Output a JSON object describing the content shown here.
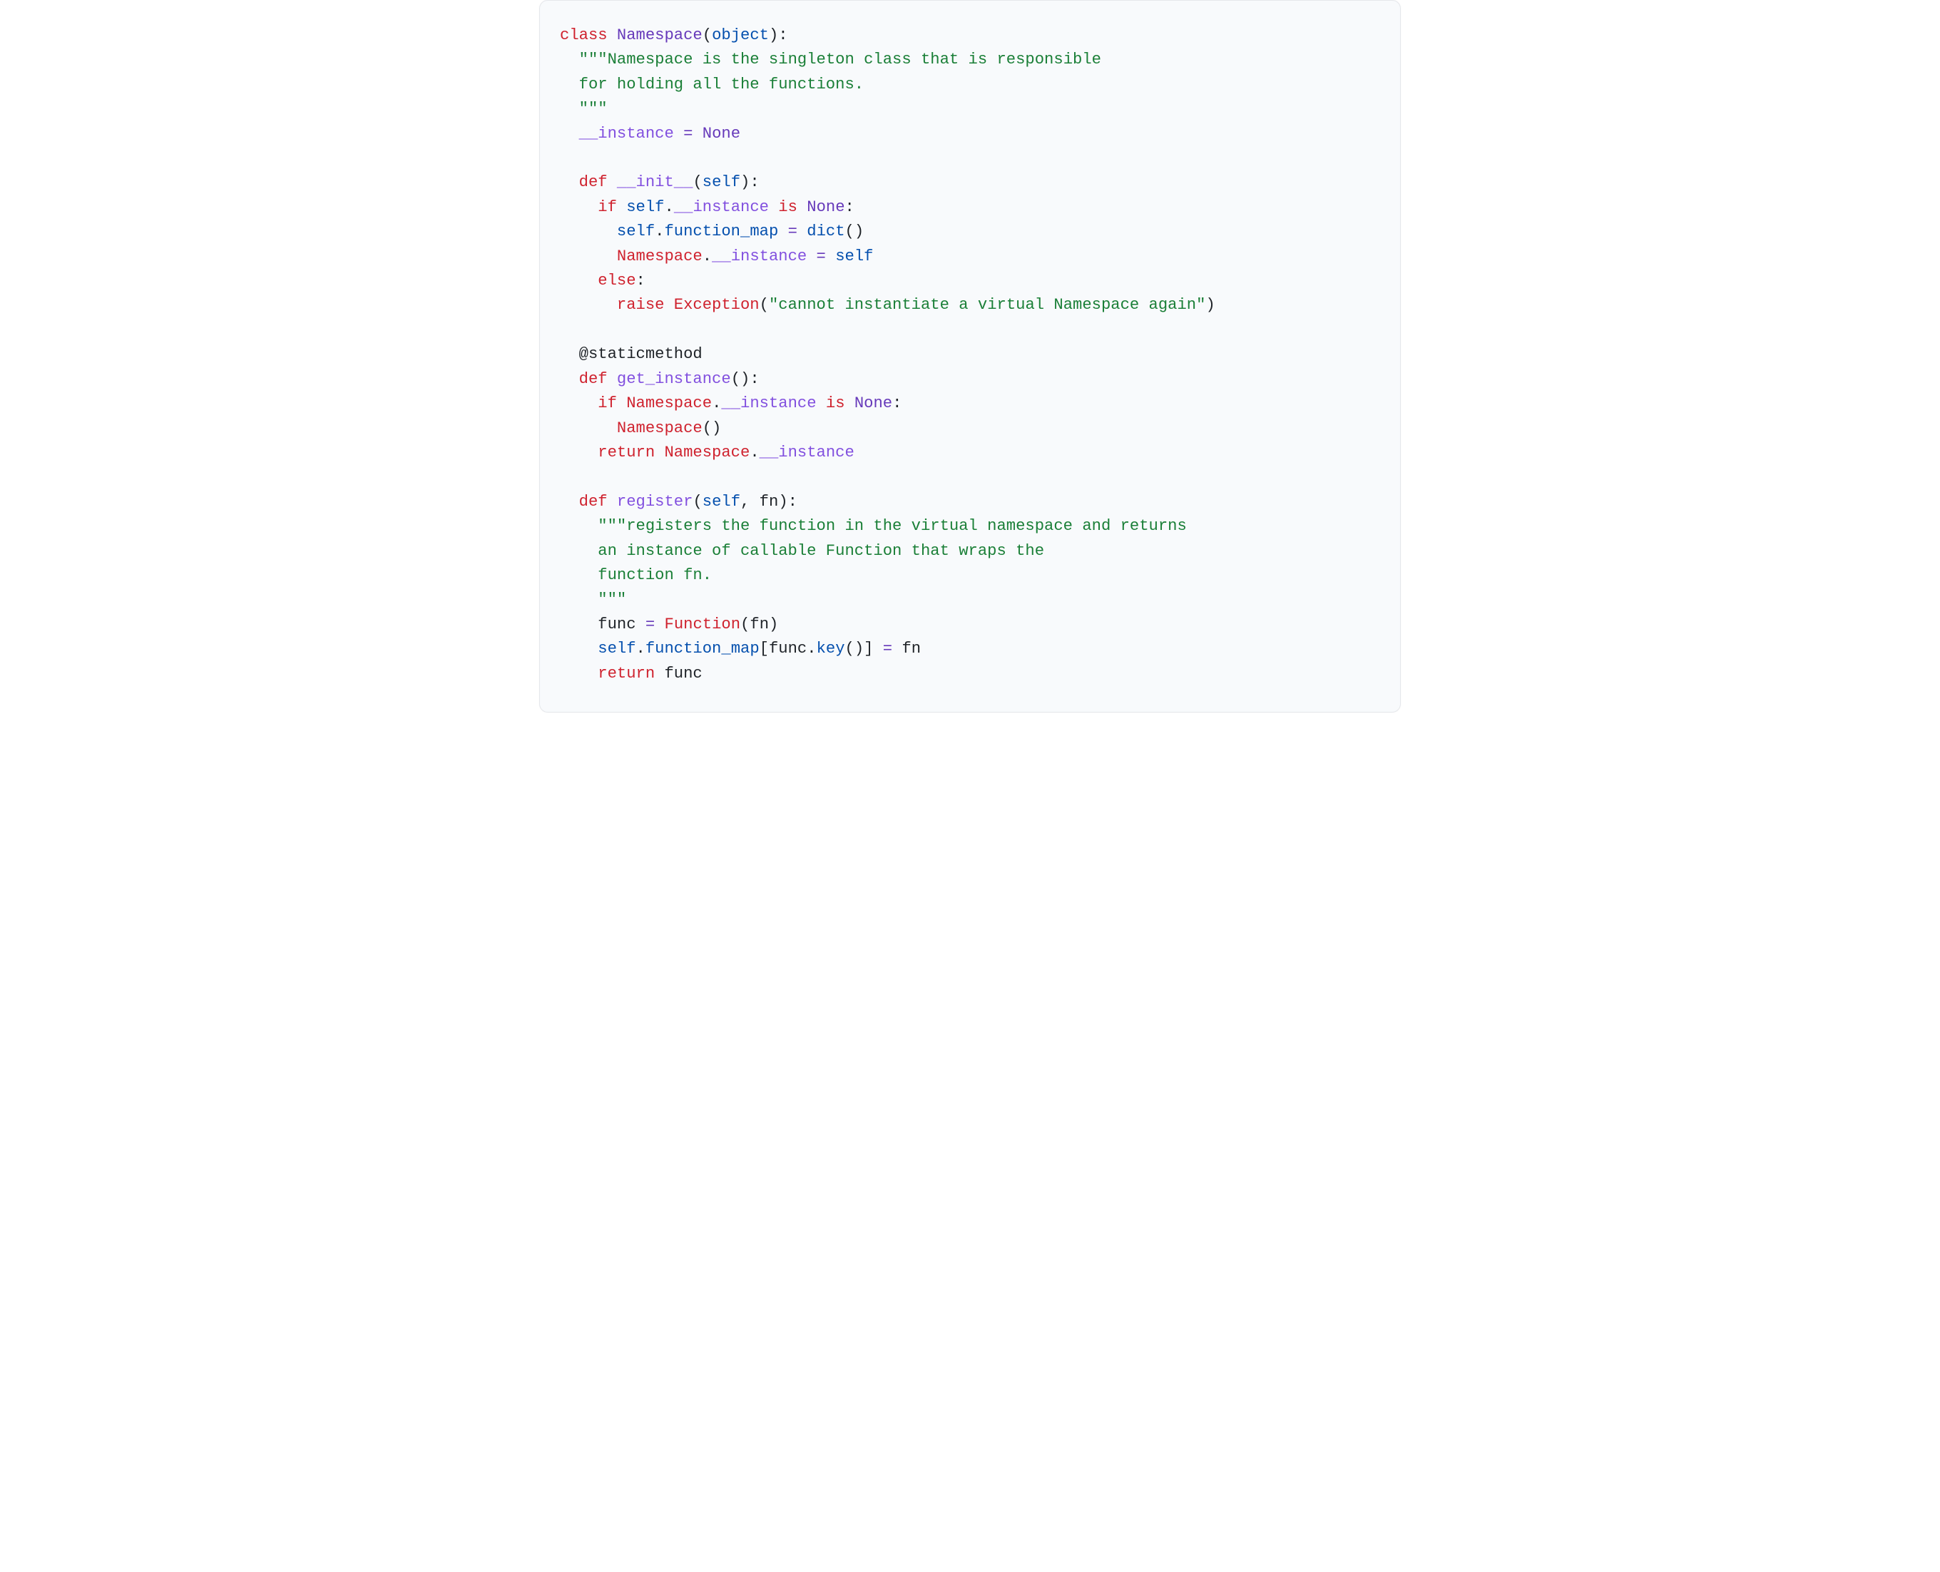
{
  "code": {
    "lines": [
      [
        {
          "t": "class ",
          "c": "kw"
        },
        {
          "t": "Namespace",
          "c": "cls"
        },
        {
          "t": "(",
          "c": "pun"
        },
        {
          "t": "object",
          "c": "bi"
        },
        {
          "t": "):",
          "c": "pun"
        }
      ],
      [
        {
          "t": "  ",
          "c": "pun"
        },
        {
          "t": "\"\"\"Namespace is the singleton class that is responsible",
          "c": "str"
        }
      ],
      [
        {
          "t": "  for holding all the functions.",
          "c": "str"
        }
      ],
      [
        {
          "t": "  \"\"\"",
          "c": "str"
        }
      ],
      [
        {
          "t": "  ",
          "c": "pun"
        },
        {
          "t": "__instance",
          "c": "dun"
        },
        {
          "t": " ",
          "c": "pun"
        },
        {
          "t": "=",
          "c": "op"
        },
        {
          "t": " ",
          "c": "pun"
        },
        {
          "t": "None",
          "c": "cls"
        }
      ],
      [
        {
          "t": "",
          "c": "pun"
        }
      ],
      [
        {
          "t": "  ",
          "c": "pun"
        },
        {
          "t": "def ",
          "c": "kw"
        },
        {
          "t": "__init__",
          "c": "fn"
        },
        {
          "t": "(",
          "c": "pun"
        },
        {
          "t": "self",
          "c": "self"
        },
        {
          "t": "):",
          "c": "pun"
        }
      ],
      [
        {
          "t": "    ",
          "c": "pun"
        },
        {
          "t": "if ",
          "c": "kw"
        },
        {
          "t": "self",
          "c": "self"
        },
        {
          "t": ".",
          "c": "pun"
        },
        {
          "t": "__instance",
          "c": "dun"
        },
        {
          "t": " ",
          "c": "pun"
        },
        {
          "t": "is ",
          "c": "kw"
        },
        {
          "t": "None",
          "c": "cls"
        },
        {
          "t": ":",
          "c": "pun"
        }
      ],
      [
        {
          "t": "      ",
          "c": "pun"
        },
        {
          "t": "self",
          "c": "self"
        },
        {
          "t": ".",
          "c": "pun"
        },
        {
          "t": "function_map",
          "c": "attr"
        },
        {
          "t": " ",
          "c": "pun"
        },
        {
          "t": "=",
          "c": "op"
        },
        {
          "t": " ",
          "c": "pun"
        },
        {
          "t": "dict",
          "c": "bi"
        },
        {
          "t": "()",
          "c": "pun"
        }
      ],
      [
        {
          "t": "      ",
          "c": "pun"
        },
        {
          "t": "Namespace",
          "c": "callr"
        },
        {
          "t": ".",
          "c": "pun"
        },
        {
          "t": "__instance",
          "c": "dun"
        },
        {
          "t": " ",
          "c": "pun"
        },
        {
          "t": "=",
          "c": "op"
        },
        {
          "t": " ",
          "c": "pun"
        },
        {
          "t": "self",
          "c": "self"
        }
      ],
      [
        {
          "t": "    ",
          "c": "pun"
        },
        {
          "t": "else",
          "c": "kw"
        },
        {
          "t": ":",
          "c": "pun"
        }
      ],
      [
        {
          "t": "      ",
          "c": "pun"
        },
        {
          "t": "raise ",
          "c": "kw"
        },
        {
          "t": "Exception",
          "c": "callr"
        },
        {
          "t": "(",
          "c": "pun"
        },
        {
          "t": "\"cannot instantiate a virtual Namespace again\"",
          "c": "str"
        },
        {
          "t": ")",
          "c": "pun"
        }
      ],
      [
        {
          "t": "",
          "c": "pun"
        }
      ],
      [
        {
          "t": "  ",
          "c": "pun"
        },
        {
          "t": "@staticmethod",
          "c": "decor"
        }
      ],
      [
        {
          "t": "  ",
          "c": "pun"
        },
        {
          "t": "def ",
          "c": "kw"
        },
        {
          "t": "get_instance",
          "c": "fn"
        },
        {
          "t": "():",
          "c": "pun"
        }
      ],
      [
        {
          "t": "    ",
          "c": "pun"
        },
        {
          "t": "if ",
          "c": "kw"
        },
        {
          "t": "Namespace",
          "c": "callr"
        },
        {
          "t": ".",
          "c": "pun"
        },
        {
          "t": "__instance",
          "c": "dun"
        },
        {
          "t": " ",
          "c": "pun"
        },
        {
          "t": "is ",
          "c": "kw"
        },
        {
          "t": "None",
          "c": "cls"
        },
        {
          "t": ":",
          "c": "pun"
        }
      ],
      [
        {
          "t": "      ",
          "c": "pun"
        },
        {
          "t": "Namespace",
          "c": "callr"
        },
        {
          "t": "()",
          "c": "pun"
        }
      ],
      [
        {
          "t": "    ",
          "c": "pun"
        },
        {
          "t": "return ",
          "c": "kw"
        },
        {
          "t": "Namespace",
          "c": "callr"
        },
        {
          "t": ".",
          "c": "pun"
        },
        {
          "t": "__instance",
          "c": "dun"
        }
      ],
      [
        {
          "t": "",
          "c": "pun"
        }
      ],
      [
        {
          "t": "  ",
          "c": "pun"
        },
        {
          "t": "def ",
          "c": "kw"
        },
        {
          "t": "register",
          "c": "fn"
        },
        {
          "t": "(",
          "c": "pun"
        },
        {
          "t": "self",
          "c": "self"
        },
        {
          "t": ", ",
          "c": "pun"
        },
        {
          "t": "fn",
          "c": "id"
        },
        {
          "t": "):",
          "c": "pun"
        }
      ],
      [
        {
          "t": "    ",
          "c": "pun"
        },
        {
          "t": "\"\"\"registers the function in the virtual namespace and returns",
          "c": "str"
        }
      ],
      [
        {
          "t": "    an instance of callable Function that wraps the",
          "c": "str"
        }
      ],
      [
        {
          "t": "    function fn.",
          "c": "str"
        }
      ],
      [
        {
          "t": "    \"\"\"",
          "c": "str"
        }
      ],
      [
        {
          "t": "    ",
          "c": "pun"
        },
        {
          "t": "func",
          "c": "id"
        },
        {
          "t": " ",
          "c": "pun"
        },
        {
          "t": "=",
          "c": "op"
        },
        {
          "t": " ",
          "c": "pun"
        },
        {
          "t": "Function",
          "c": "callr"
        },
        {
          "t": "(",
          "c": "pun"
        },
        {
          "t": "fn",
          "c": "id"
        },
        {
          "t": ")",
          "c": "pun"
        }
      ],
      [
        {
          "t": "    ",
          "c": "pun"
        },
        {
          "t": "self",
          "c": "self"
        },
        {
          "t": ".",
          "c": "pun"
        },
        {
          "t": "function_map",
          "c": "attr"
        },
        {
          "t": "[",
          "c": "pun"
        },
        {
          "t": "func",
          "c": "id"
        },
        {
          "t": ".",
          "c": "pun"
        },
        {
          "t": "key",
          "c": "attr"
        },
        {
          "t": "()]",
          "c": "pun"
        },
        {
          "t": " ",
          "c": "pun"
        },
        {
          "t": "=",
          "c": "op"
        },
        {
          "t": " ",
          "c": "pun"
        },
        {
          "t": "fn",
          "c": "id"
        }
      ],
      [
        {
          "t": "    ",
          "c": "pun"
        },
        {
          "t": "return ",
          "c": "kw"
        },
        {
          "t": "func",
          "c": "id"
        }
      ]
    ]
  }
}
